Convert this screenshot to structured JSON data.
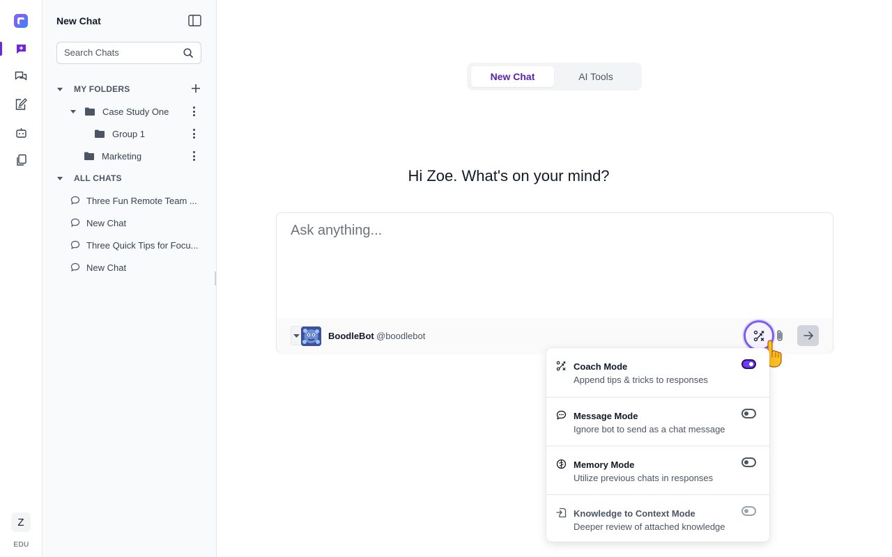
{
  "rail": {
    "avatar_initial": "Z",
    "plan_label": "EDU",
    "accent_color": "#6d28d9"
  },
  "sidebar": {
    "title": "New Chat",
    "search_placeholder": "Search Chats",
    "folders_heading": "MY FOLDERS",
    "folders": [
      {
        "name": "Case Study One",
        "expanded": true
      },
      {
        "name": "Group 1"
      },
      {
        "name": "Marketing"
      }
    ],
    "chats_heading": "ALL CHATS",
    "chats": [
      "Three Fun Remote Team ...",
      "New Chat",
      "Three Quick Tips for Focu...",
      "New Chat"
    ]
  },
  "main": {
    "tabs": [
      {
        "label": "New Chat",
        "active": true
      },
      {
        "label": "AI Tools",
        "active": false
      }
    ],
    "greeting": "Hi Zoe. What's on your mind?",
    "composer": {
      "placeholder": "Ask anything...",
      "bot_name": "BoodleBot",
      "bot_handle": "@boodlebot"
    }
  },
  "mode_menu": {
    "items": [
      {
        "title": "Coach Mode",
        "description": "Append tips & tricks to responses",
        "enabled": true,
        "icon": "coach-icon"
      },
      {
        "title": "Message Mode",
        "description": "Ignore bot to send as a chat message",
        "enabled": false,
        "icon": "message-bubble-icon"
      },
      {
        "title": "Memory Mode",
        "description": "Utilize previous chats in responses",
        "enabled": false,
        "icon": "brain-icon"
      },
      {
        "title": "Knowledge to Context Mode",
        "description": "Deeper review of attached knowledge",
        "enabled": false,
        "disabled": true,
        "icon": "knowledge-import-icon"
      }
    ]
  }
}
